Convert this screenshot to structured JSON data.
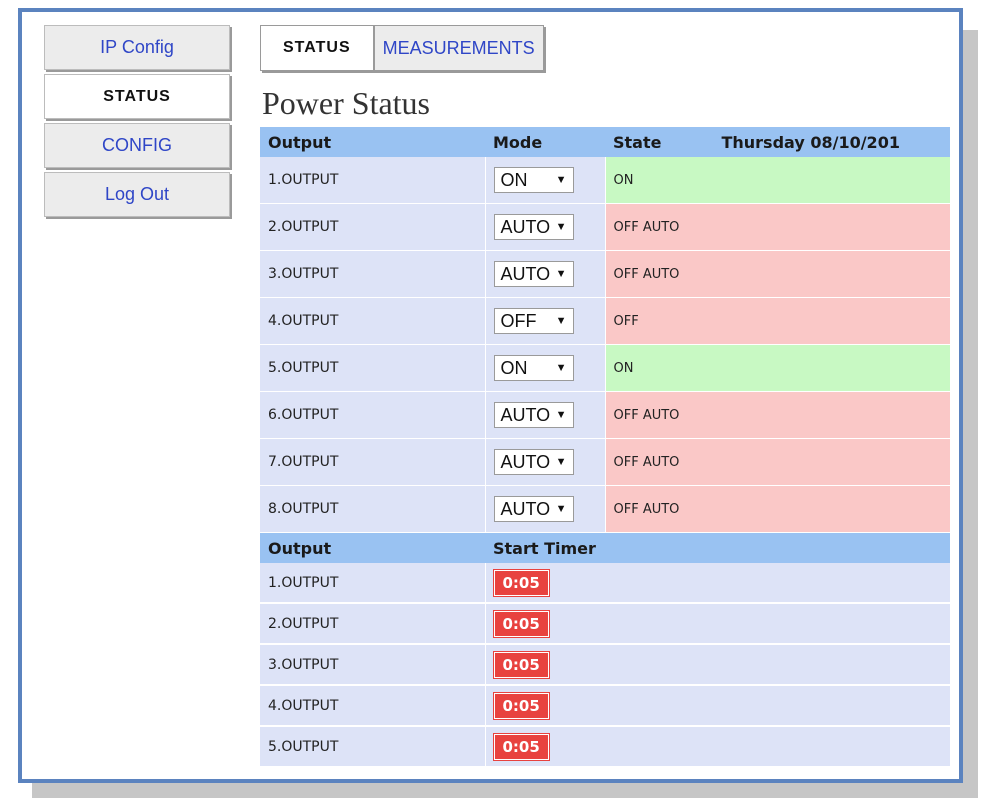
{
  "menu": [
    {
      "label": "IP Config",
      "active": false
    },
    {
      "label": "STATUS",
      "active": true
    },
    {
      "label": "CONFIG",
      "active": false
    },
    {
      "label": "Log Out",
      "active": false
    }
  ],
  "tabs": [
    {
      "label": "STATUS",
      "active": true
    },
    {
      "label": "MEASUREMENTS",
      "active": false
    }
  ],
  "page_title": "Power Status",
  "status_table": {
    "headers": {
      "output": "Output",
      "mode": "Mode",
      "state": "State",
      "date": "Thursday 08/10/201"
    },
    "rows": [
      {
        "output": "1.OUTPUT",
        "mode": "ON",
        "state": "ON",
        "state_kind": "on"
      },
      {
        "output": "2.OUTPUT",
        "mode": "AUTO",
        "state": "OFF AUTO",
        "state_kind": "off"
      },
      {
        "output": "3.OUTPUT",
        "mode": "AUTO",
        "state": "OFF AUTO",
        "state_kind": "off"
      },
      {
        "output": "4.OUTPUT",
        "mode": "OFF",
        "state": "OFF",
        "state_kind": "off"
      },
      {
        "output": "5.OUTPUT",
        "mode": "ON",
        "state": "ON",
        "state_kind": "on"
      },
      {
        "output": "6.OUTPUT",
        "mode": "AUTO",
        "state": "OFF AUTO",
        "state_kind": "off"
      },
      {
        "output": "7.OUTPUT",
        "mode": "AUTO",
        "state": "OFF AUTO",
        "state_kind": "off"
      },
      {
        "output": "8.OUTPUT",
        "mode": "AUTO",
        "state": "OFF AUTO",
        "state_kind": "off"
      }
    ]
  },
  "timer_table": {
    "headers": {
      "output": "Output",
      "timer": "Start Timer"
    },
    "rows": [
      {
        "output": "1.OUTPUT",
        "timer": "0:05"
      },
      {
        "output": "2.OUTPUT",
        "timer": "0:05"
      },
      {
        "output": "3.OUTPUT",
        "timer": "0:05"
      },
      {
        "output": "4.OUTPUT",
        "timer": "0:05"
      },
      {
        "output": "5.OUTPUT",
        "timer": "0:05"
      }
    ]
  },
  "icons": {
    "select_arrow": "dropdown-arrow-icon"
  },
  "colors": {
    "frame_border": "#5b83bf",
    "header_bg": "#99c2f2",
    "row_bg": "#dde3f7",
    "state_on": "#c8f9c3",
    "state_off": "#fac8c7",
    "timer_badge": "#e8423f",
    "link": "#2f46c7"
  }
}
